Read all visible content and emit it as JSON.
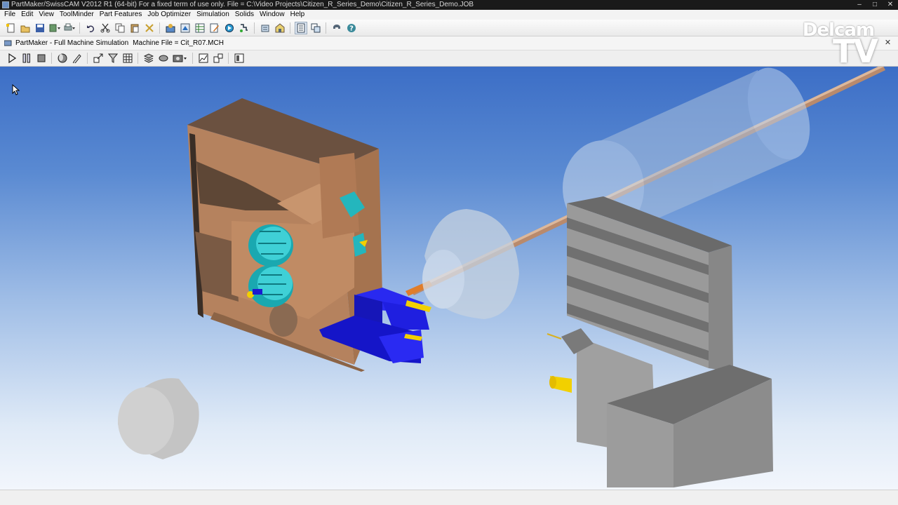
{
  "window": {
    "title": "PartMaker/SwissCAM V2012 R1 (64-bit)  For a fixed term of use only.    File = C:\\Video Projects\\Citizen_R_Series_Demo\\Citizen_R_Series_Demo.JOB",
    "controls": [
      "–",
      "□",
      "✕"
    ]
  },
  "menu": [
    "File",
    "Edit",
    "View",
    "ToolMinder",
    "Part Features",
    "Job Optimizer",
    "Simulation",
    "Solids",
    "Window",
    "Help"
  ],
  "document": {
    "title": "PartMaker - Full Machine Simulation",
    "machine_file": "Machine File = Cit_R07.MCH",
    "close": "✕"
  },
  "watermark": {
    "line1": "Delcam",
    "line2": "TV"
  },
  "colors": {
    "viewport_top": "#3c6ec6",
    "viewport_bottom": "#f2f6fc",
    "turret": "#b5825e",
    "tool_holder": "#1f1fe8",
    "tool_teal": "#1fb7bf",
    "insert_yellow": "#f2d000",
    "gang_block": "#8a8a8a",
    "bar_stock": "#b98a6c"
  }
}
